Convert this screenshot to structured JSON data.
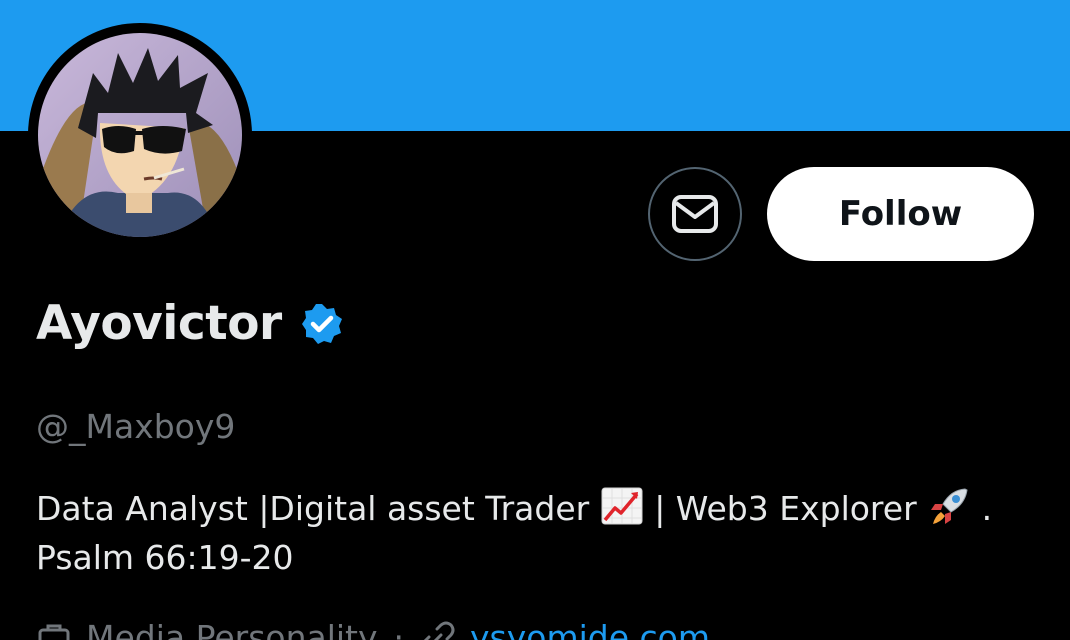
{
  "profile": {
    "display_name": "Ayovictor",
    "handle": "@_Maxboy9",
    "verified": true,
    "bio_line1_a": "Data Analyst |Digital asset Trader",
    "bio_line1_b": "| Web3 Explorer",
    "bio_line1_c": ".",
    "bio_line2": "Psalm 66:19-20",
    "category": "Media Personality",
    "website": "ysyomide.com",
    "avatar": "avatar-image"
  },
  "actions": {
    "message_icon": "envelope-icon",
    "follow_label": "Follow"
  },
  "icons": {
    "bio_emoji_1": "chart-increasing-emoji",
    "bio_emoji_2": "rocket-emoji",
    "category_icon": "briefcase-icon",
    "link_icon": "link-icon"
  },
  "colors": {
    "banner": "#1d9bf0",
    "background": "#000000",
    "verified_badge": "#1d9bf0",
    "link": "#1d9bf0",
    "muted_text": "#71767b"
  }
}
